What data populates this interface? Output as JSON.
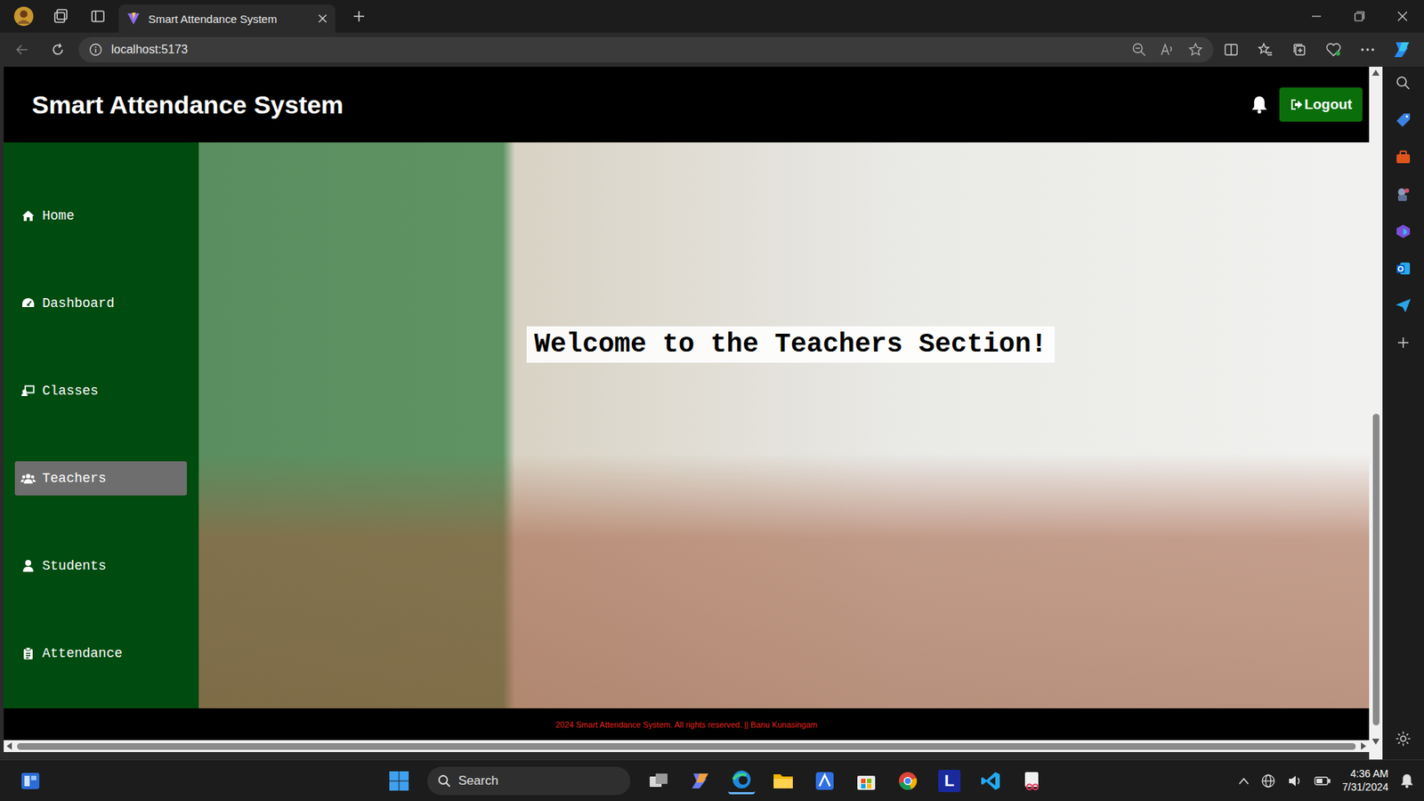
{
  "browser": {
    "tab_title": "Smart Attendance System",
    "url": "localhost:5173"
  },
  "app": {
    "title": "Smart Attendance System",
    "logout": "Logout"
  },
  "sidebar": {
    "items": [
      {
        "label": "Home",
        "selected": false
      },
      {
        "label": "Dashboard",
        "selected": false
      },
      {
        "label": "Classes",
        "selected": false
      },
      {
        "label": "Teachers",
        "selected": true
      },
      {
        "label": "Students",
        "selected": false
      },
      {
        "label": "Attendance",
        "selected": false
      }
    ]
  },
  "hero": {
    "welcome": "Welcome to the Teachers Section!"
  },
  "footer": {
    "text": "2024 Smart Attendance System. All rights reserved. || Banu Kunasingam"
  },
  "taskbar": {
    "search": "Search",
    "app_letter": "L",
    "time": "4:36 AM",
    "date": "7/31/2024"
  }
}
